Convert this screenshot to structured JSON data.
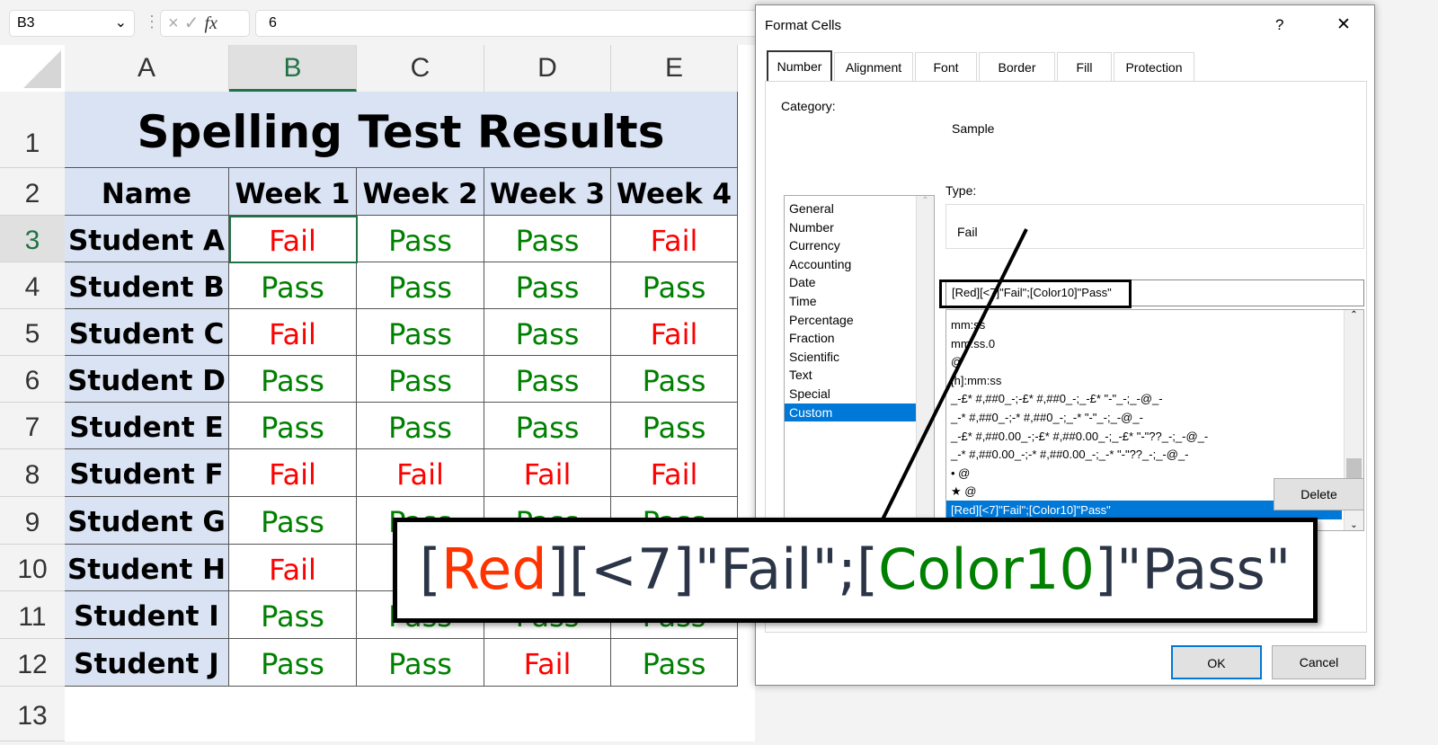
{
  "formula_bar": {
    "name_box": "B3",
    "cancel_icon": "×",
    "enter_icon": "✓",
    "fx": "fx",
    "value": "6"
  },
  "columns": [
    "A",
    "B",
    "C",
    "D",
    "E"
  ],
  "rows": [
    "1",
    "2",
    "3",
    "4",
    "5",
    "6",
    "7",
    "8",
    "9",
    "10",
    "11",
    "12",
    "13"
  ],
  "sheet": {
    "title": "Spelling Test Results",
    "headers": [
      "Name",
      "Week 1",
      "Week 2",
      "Week 3",
      "Week 4"
    ],
    "students": [
      {
        "name": "Student A",
        "results": [
          "Fail",
          "Pass",
          "Pass",
          "Fail"
        ]
      },
      {
        "name": "Student B",
        "results": [
          "Pass",
          "Pass",
          "Pass",
          "Pass"
        ]
      },
      {
        "name": "Student C",
        "results": [
          "Fail",
          "Pass",
          "Pass",
          "Fail"
        ]
      },
      {
        "name": "Student D",
        "results": [
          "Pass",
          "Pass",
          "Pass",
          "Pass"
        ]
      },
      {
        "name": "Student E",
        "results": [
          "Pass",
          "Pass",
          "Pass",
          "Pass"
        ]
      },
      {
        "name": "Student F",
        "results": [
          "Fail",
          "Fail",
          "Fail",
          "Fail"
        ]
      },
      {
        "name": "Student G",
        "results": [
          "Pass",
          "Pass",
          "Pass",
          "Pass"
        ]
      },
      {
        "name": "Student H",
        "results": [
          "Fail",
          "",
          "",
          ""
        ]
      },
      {
        "name": "Student I",
        "results": [
          "Pass",
          "Pass",
          "Pass",
          "Pass"
        ]
      },
      {
        "name": "Student J",
        "results": [
          "Pass",
          "Pass",
          "Fail",
          "Pass"
        ]
      }
    ]
  },
  "dialog": {
    "title": "Format Cells",
    "help": "?",
    "close": "✕",
    "tabs": [
      "Number",
      "Alignment",
      "Font",
      "Border",
      "Fill",
      "Protection"
    ],
    "category_label": "Category:",
    "categories": [
      "General",
      "Number",
      "Currency",
      "Accounting",
      "Date",
      "Time",
      "Percentage",
      "Fraction",
      "Scientific",
      "Text",
      "Special",
      "Custom"
    ],
    "selected_category": "Custom",
    "sample_label": "Sample",
    "sample_value": "Fail",
    "type_label": "Type:",
    "type_value": "[Red][<7]\"Fail\";[Color10]\"Pass\"",
    "type_list": [
      "mm:ss",
      "mm:ss.0",
      "@",
      "[h]:mm:ss",
      "_-£* #,##0_-;-£* #,##0_-;_-£* \"-\"_-;_-@_-",
      "_-* #,##0_-;-* #,##0_-;_-* \"-\"_-;_-@_-",
      "_-£* #,##0.00_-;-£* #,##0.00_-;_-£* \"-\"??_-;_-@_-",
      "_-* #,##0.00_-;-* #,##0.00_-;_-* \"-\"??_-;_-@_-",
      "• @",
      "★ @",
      "[Red][<7]\"Fail\";[Color10]\"Pass\""
    ],
    "delete": "Delete",
    "ok": "OK",
    "cancel": "Cancel"
  },
  "callout": {
    "parts": [
      "[",
      "Red",
      "][<7]\"Fail\";[",
      "Color10",
      "]\"Pass\""
    ]
  },
  "colors": {
    "pass": "#008000",
    "fail": "#ff0000",
    "callout_red": "#ff3300",
    "callout_green": "#008000",
    "selection": "#0078d7",
    "header_fill": "#dae3f3"
  }
}
